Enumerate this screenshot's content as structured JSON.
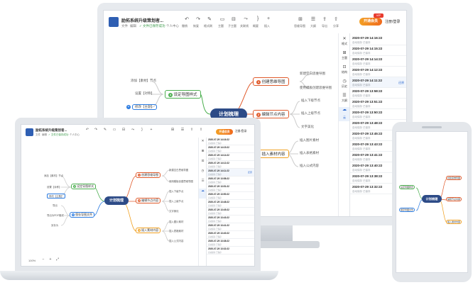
{
  "app": {
    "title": "励拓系统升级策划者...",
    "menu": [
      "文件",
      "编辑"
    ],
    "save_status": "✓ 文件已保存成功",
    "user": "个人中心",
    "toolbar": [
      "撤销",
      "恢复",
      "格式刷",
      "主题",
      "子主题",
      "关联线",
      "概要",
      "插入"
    ],
    "right_tools": [
      "思维导图",
      "大纲",
      "导出",
      "分享"
    ],
    "vip_label": "开通会员",
    "vip_badge": "VIP",
    "login_label": "注册/登录"
  },
  "mindmap": {
    "root": "计划梳理",
    "branches": [
      {
        "num": "1",
        "label": "创建思维导图",
        "color": "#e05a2b",
        "leaves": [
          "新建空白思维导图",
          "使用模板创建思维导图"
        ]
      },
      {
        "num": "2",
        "label": "编辑节点内容",
        "color": "#e05a2b",
        "leaves": [
          "插入下级节点",
          "插入上级节点",
          "文字美化"
        ]
      },
      {
        "num": "3",
        "label": "插入素材内容",
        "color": "#f0a020",
        "leaves": [
          "插入图片素材",
          "插入表格素材",
          "插入公式内容"
        ]
      },
      {
        "num": "4",
        "label": "设定导图样式",
        "color": "#4caf50",
        "leaves": [
          "添加【素材】节点",
          "设置【对称】",
          "修改【主题】"
        ]
      },
      {
        "num": "5",
        "label": "保存导图文件",
        "color": "#2b7be0",
        "leaves": [
          "导出",
          "导出为PDF格式",
          "另存为"
        ]
      }
    ]
  },
  "rail": [
    "格式",
    "主题",
    "结构",
    "历史",
    "大纲",
    "云",
    "更多"
  ],
  "history": {
    "subtitle": "自动保存 已保存",
    "restore_label": "还原",
    "times": [
      "2020-07-29 14:16:22",
      "2020-07-29 14:15:22",
      "2020-07-29 14:14:22",
      "2020-07-29 14:12:22",
      "2020-07-29 14:11:22",
      "2020-07-29 13:58:22",
      "2020-07-29 13:51:22",
      "2020-07-29 13:50:22",
      "2020-07-29 13:48:22",
      "2020-07-29 13:45:22",
      "2020-07-29 13:43:22",
      "2020-07-29 13:41:22",
      "2020-07-29 13:40:22",
      "2020-07-29 13:38:22",
      "2020-07-29 13:32:22"
    ]
  },
  "zoom": "100%",
  "colors": {
    "root": "#2d4b87",
    "accent": "#2f5fb3",
    "vip": "#f28a20",
    "red": "#e05a2b",
    "orange": "#f0a020",
    "green": "#4caf50",
    "blue": "#2b7be0"
  }
}
